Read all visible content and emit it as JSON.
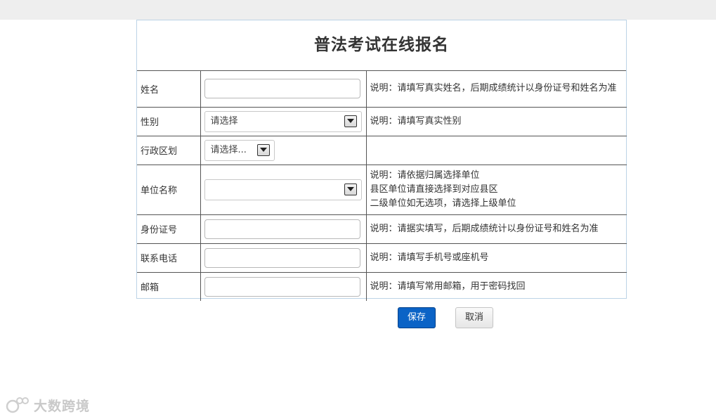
{
  "page": {
    "title": "普法考试在线报名"
  },
  "form": {
    "name": {
      "label": "姓名",
      "value": "",
      "note": "说明：请填写真实姓名，后期成绩统计以身份证号和姓名为准"
    },
    "gender": {
      "label": "性别",
      "selected": "请选择",
      "note": "说明：请填写真实性别"
    },
    "region": {
      "label": "行政区划",
      "selected": "请选择...",
      "note": ""
    },
    "unit": {
      "label": "单位名称",
      "selected": "",
      "note_lines": [
        "说明：请依据归属选择单位",
        "县区单位请直接选择到对应县区",
        "二级单位如无选项，请选择上级单位"
      ]
    },
    "id_number": {
      "label": "身份证号",
      "value": "",
      "note": "说明：请据实填写，后期成绩统计以身份证号和姓名为准"
    },
    "phone": {
      "label": "联系电话",
      "value": "",
      "note": "说明：请填写手机号或座机号"
    },
    "email": {
      "label": "邮箱",
      "value": "",
      "note": "说明：请填写常用邮箱，用于密码找回"
    }
  },
  "buttons": {
    "save": "保存",
    "cancel": "取消"
  },
  "watermark": {
    "text": "大数跨境",
    "icon": "watermark-logo-icon"
  }
}
